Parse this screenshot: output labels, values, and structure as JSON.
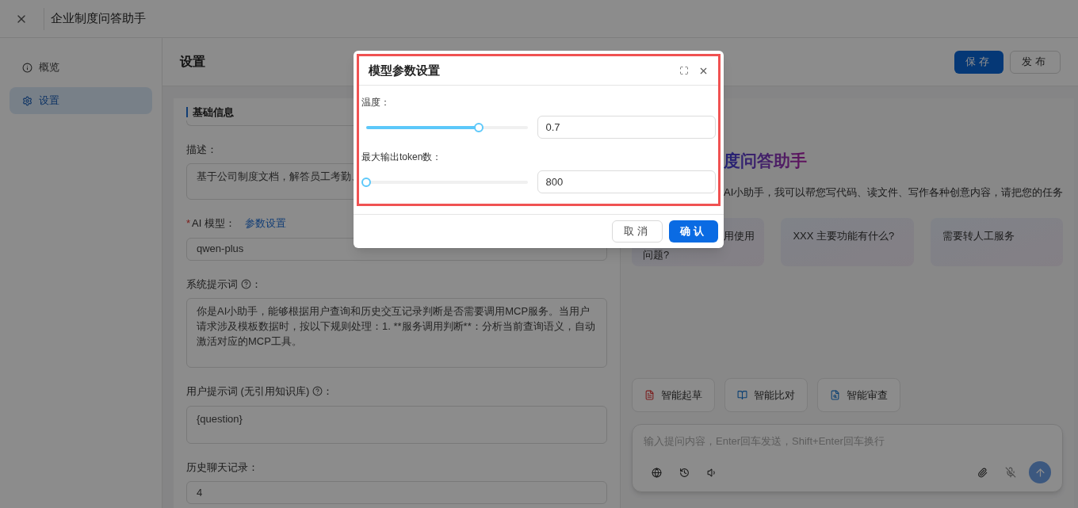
{
  "app": {
    "title": "企业制度问答助手"
  },
  "sidebar": {
    "items": [
      {
        "label": "概览",
        "selected": false
      },
      {
        "label": "设置",
        "selected": true
      }
    ]
  },
  "page": {
    "title": "设置",
    "buttons": [
      {
        "label": "保存",
        "kind": "primary"
      },
      {
        "label": "发布",
        "kind": "default"
      }
    ]
  },
  "form": {
    "section_title": "基础信息",
    "fields": [
      {
        "kind": "textarea",
        "label": "描述：",
        "value": "基于公司制度文档，解答员工考勤、"
      },
      {
        "kind": "select",
        "required_mark": "*",
        "label": "AI 模型：",
        "link": "参数设置",
        "value": "qwen-plus"
      },
      {
        "kind": "textarea",
        "label": "系统提示词",
        "help": true,
        "suffix": "：",
        "value": "你是AI小助手，能够根据用户查询和历史交互记录判断是否需要调用MCP服务。当用户请求涉及模板数据时，按以下规则处理：1. **服务调用判断**：分析当前查询语义，自动激活对应的MCP工具。"
      },
      {
        "kind": "textarea",
        "label": "用户提示词 (无引用知识库)",
        "help": true,
        "suffix": "：",
        "value": "{question}"
      },
      {
        "kind": "input",
        "label": "历史聊天记录：",
        "value": "4"
      }
    ]
  },
  "chat": {
    "welcome_title": "度问答助手",
    "welcome_text": "AI小助手，我可以帮您写代码、读文件、写作各种创意内容，请把您的任务",
    "suggestions": [
      {
        "lines": [
          "用使用",
          "问题?"
        ]
      },
      {
        "lines": [
          "XXX 主要功能有什么?"
        ]
      },
      {
        "lines": [
          "需要转人工服务"
        ]
      }
    ],
    "tools": [
      {
        "label": "智能起草"
      },
      {
        "label": "智能比对"
      },
      {
        "label": "智能审查"
      }
    ],
    "input": {
      "placeholder": "输入提问内容，Enter回车发送，Shift+Enter回车换行"
    }
  },
  "modal": {
    "title": "模型参数设置",
    "params": [
      {
        "label": "温度：",
        "level": 0.7,
        "value": "0.7"
      },
      {
        "label": "最大输出token数：",
        "level": 0,
        "value": "800"
      }
    ],
    "buttons": [
      {
        "label": "取消",
        "kind": "default"
      },
      {
        "label": "确认",
        "kind": "primary"
      }
    ]
  }
}
